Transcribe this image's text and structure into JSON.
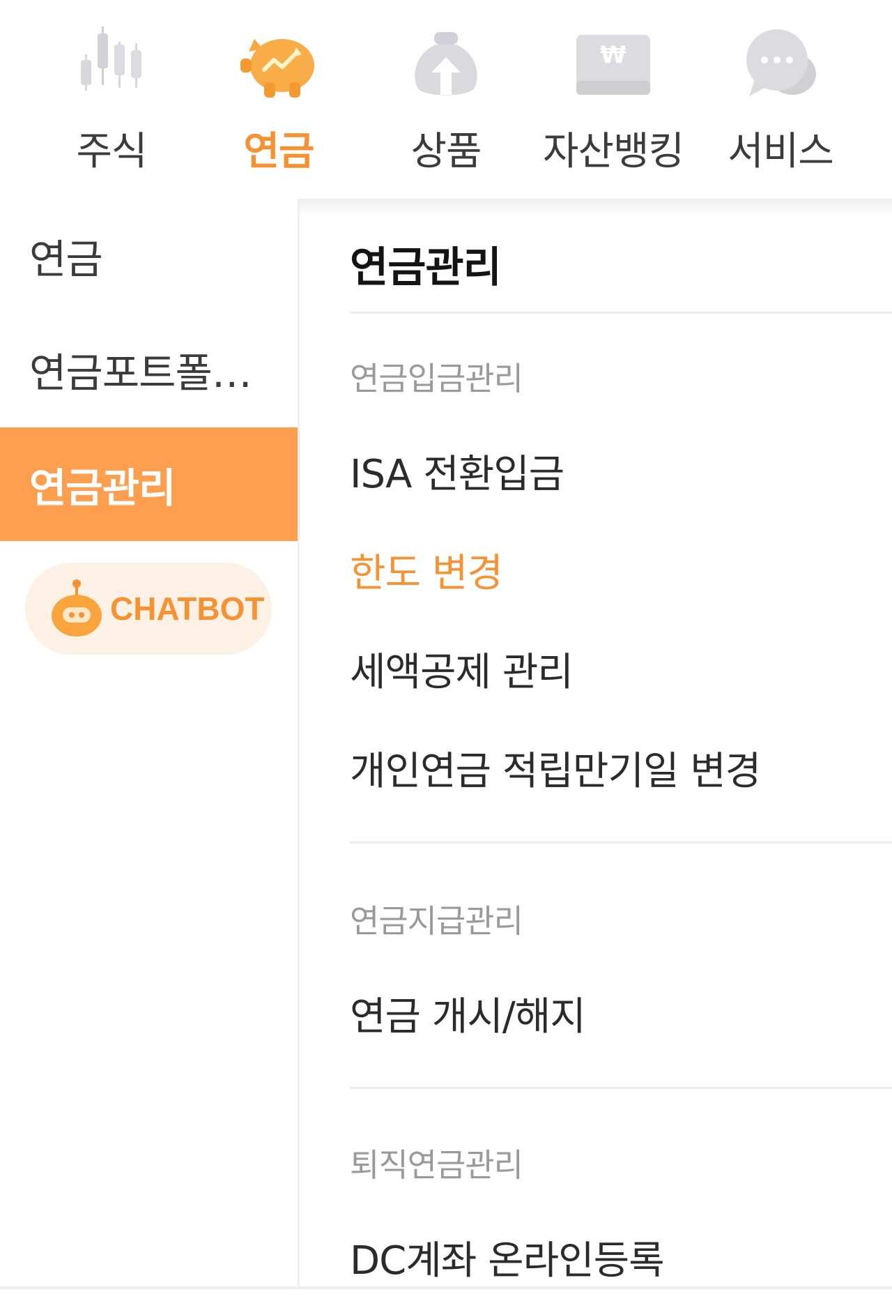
{
  "topnav": {
    "items": [
      {
        "label": "주식",
        "icon": "stock-chart-icon",
        "active": false
      },
      {
        "label": "연금",
        "icon": "piggy-bank-icon",
        "active": true
      },
      {
        "label": "상품",
        "icon": "money-bag-icon",
        "active": false
      },
      {
        "label": "자산뱅킹",
        "icon": "won-card-icon",
        "active": false
      },
      {
        "label": "서비스",
        "icon": "chat-bubble-icon",
        "active": false
      }
    ]
  },
  "sidebar": {
    "items": [
      {
        "label": "연금",
        "active": false
      },
      {
        "label": "연금포트폴…",
        "active": false
      },
      {
        "label": "연금관리",
        "active": true
      }
    ],
    "chatbot": {
      "label": "CHATBOT",
      "icon": "robot-icon"
    }
  },
  "content": {
    "title": "연금관리",
    "sections": [
      {
        "heading": "연금입금관리",
        "links": [
          {
            "label": "ISA 전환입금",
            "highlight": false
          },
          {
            "label": "한도 변경",
            "highlight": true
          },
          {
            "label": "세액공제 관리",
            "highlight": false
          },
          {
            "label": "개인연금 적립만기일 변경",
            "highlight": false
          }
        ]
      },
      {
        "heading": "연금지급관리",
        "links": [
          {
            "label": "연금 개시/해지",
            "highlight": false
          }
        ]
      },
      {
        "heading": "퇴직연금관리",
        "links": [
          {
            "label": "DC계좌 온라인등록",
            "highlight": false
          }
        ]
      }
    ]
  },
  "colors": {
    "accent": "#f79234",
    "active_bg": "#fd9f4e",
    "chatbot_bg": "#fdf1e6",
    "section_heading": "#9a9a9a"
  }
}
